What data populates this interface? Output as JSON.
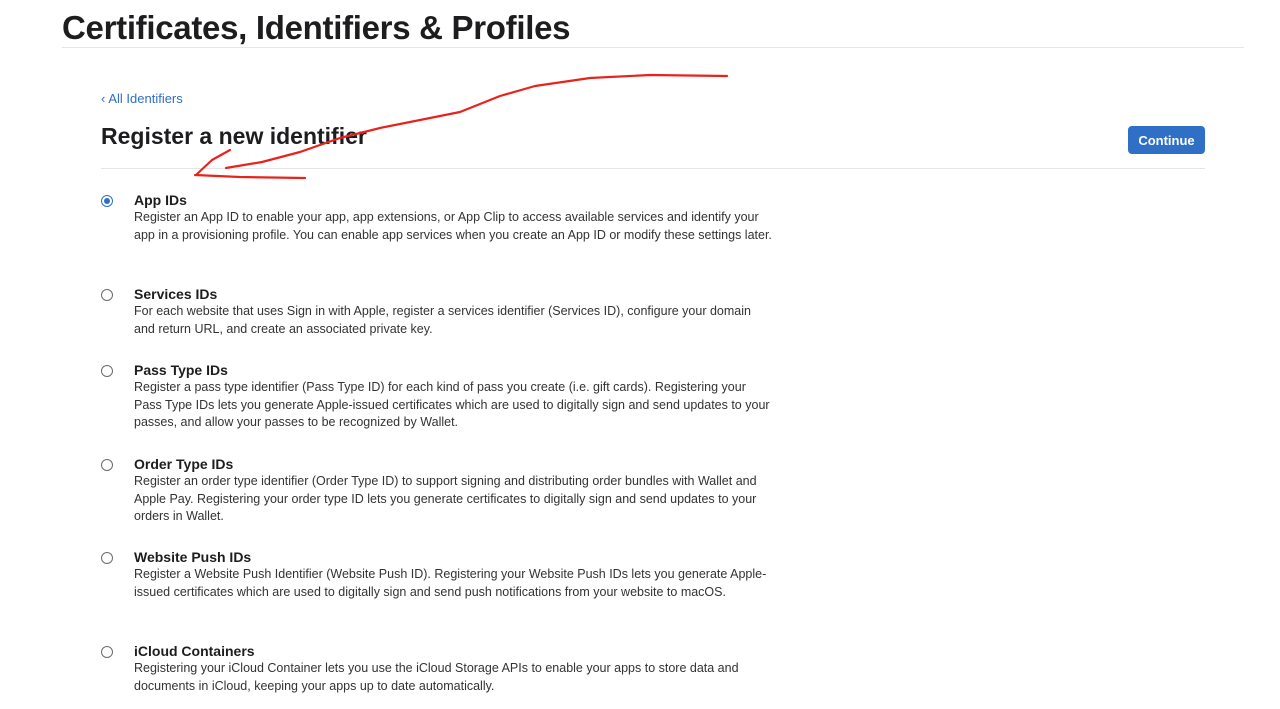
{
  "header": {
    "title": "Certificates, Identifiers & Profiles"
  },
  "nav": {
    "back_link": "All Identifiers",
    "back_chevron": "‹"
  },
  "section": {
    "title": "Register a new identifier",
    "continue_label": "Continue"
  },
  "options": [
    {
      "label": "App IDs",
      "selected": true,
      "description": "Register an App ID to enable your app, app extensions, or App Clip to access available services and identify your app in a provisioning profile. You can enable app services when you create an App ID or modify these settings later."
    },
    {
      "label": "Services IDs",
      "selected": false,
      "description": "For each website that uses Sign in with Apple, register a services identifier (Services ID), configure your domain and return URL, and create an associated private key."
    },
    {
      "label": "Pass Type IDs",
      "selected": false,
      "description": "Register a pass type identifier (Pass Type ID) for each kind of pass you create (i.e. gift cards). Registering your Pass Type IDs lets you generate Apple-issued certificates which are used to digitally sign and send updates to your passes, and allow your passes to be recognized by Wallet."
    },
    {
      "label": "Order Type IDs",
      "selected": false,
      "description": "Register an order type identifier (Order Type ID) to support signing and distributing order bundles with Wallet and Apple Pay. Registering your order type ID lets you generate certificates to digitally sign and send updates to your orders in Wallet."
    },
    {
      "label": "Website Push IDs",
      "selected": false,
      "description": "Register a Website Push Identifier (Website Push ID). Registering your Website Push IDs lets you generate Apple-issued certificates which are used to digitally sign and send push notifications from your website to macOS."
    },
    {
      "label": "iCloud Containers",
      "selected": false,
      "description": "Registering your iCloud Container lets you use the iCloud Storage APIs to enable your apps to store data and documents in iCloud, keeping your apps up to date automatically."
    }
  ],
  "colors": {
    "accent": "#2f6fc6",
    "annotation": "#e8231c"
  },
  "icons": {
    "radio_selected": "radio-selected-icon",
    "radio_unselected": "radio-unselected-icon",
    "back": "chevron-left-icon"
  }
}
